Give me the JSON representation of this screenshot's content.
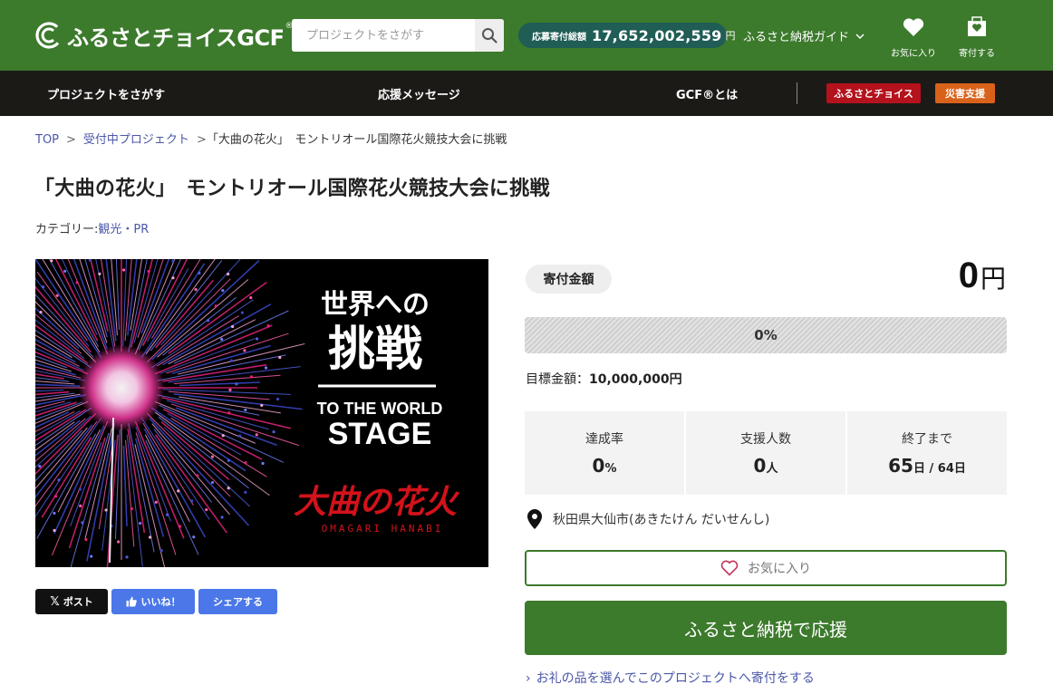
{
  "header": {
    "logo_text": "ふるさとチョイスGCF",
    "logo_reg": "®",
    "search_placeholder": "プロジェクトをさがす",
    "total_label": "応募寄付総額",
    "total_value": "17,652,002,559",
    "total_unit": "円",
    "guide_label": "ふるさと納税ガイド",
    "favorites_label": "お気に入り",
    "donate_label": "寄付する",
    "brand_color": "#3c7a2c"
  },
  "nav": {
    "find_projects": "プロジェクトをさがす",
    "messages": "応援メッセージ",
    "about_gcf": "GCF®とは",
    "tag_choice": "ふるさとチョイス",
    "tag_disaster": "災害支援"
  },
  "breadcrumb": {
    "top": "TOP",
    "sep1": ">",
    "open_projects": "受付中プロジェクト",
    "sep2": ">",
    "current": "「大曲の花火」　モントリオール国際花火競技大会に挑戦"
  },
  "page": {
    "title": "「大曲の花火」　モントリオール国際花火競技大会に挑戦",
    "category_prefix": "カテゴリー:",
    "category": "観光・PR"
  },
  "hero": {
    "line1": "世界への",
    "line2": "挑戦",
    "line3": "TO THE WORLD",
    "line4": "STAGE",
    "brand_jp": "大曲の花火",
    "brand_en": "OMAGARI HANABI"
  },
  "share": {
    "x_label": "ポスト",
    "like_label": "いいね！",
    "share_label": "シェアする"
  },
  "funding": {
    "amount_label": "寄付金額",
    "amount_value": "0",
    "amount_unit": "円",
    "progress_fraction": 0,
    "progress_label": "0%",
    "goal_label": "目標金額：",
    "goal_value": "10,000,000円",
    "stats": [
      {
        "label": "達成率",
        "value": "0",
        "unit": "%"
      },
      {
        "label": "支援人数",
        "value": "0",
        "unit": "人"
      },
      {
        "label": "終了まで",
        "value": "65",
        "unit": "日 / 64日"
      }
    ],
    "location": "秋田県大仙市(あきたけん だいせんし)",
    "favorite_button": "お気に入り",
    "support_button": "ふるさと納税で応援",
    "gift_link": "お礼の品を選んでこのプロジェクトへ寄付をする"
  }
}
